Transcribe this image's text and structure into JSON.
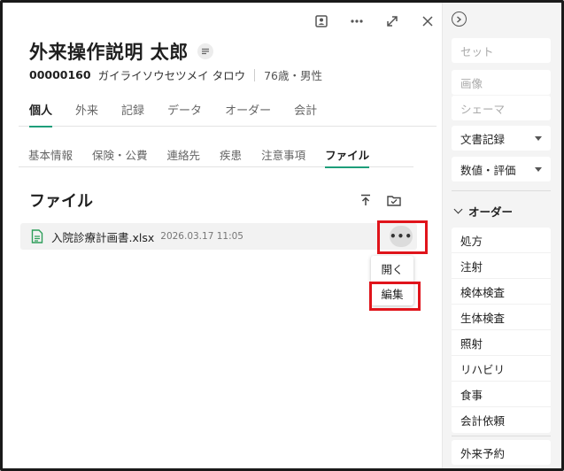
{
  "window_controls": [
    "profile-card-icon",
    "more-horizontal-icon",
    "expand-icon",
    "close-icon"
  ],
  "patient": {
    "name": "外来操作説明 太郎",
    "id": "00000160",
    "kana": "ガイライソウセツメイ タロウ",
    "age_sex": "76歳・男性"
  },
  "main_tabs": [
    "個人",
    "外来",
    "記録",
    "データ",
    "オーダー",
    "会計"
  ],
  "main_tab_active": "個人",
  "sub_tabs": [
    "基本情報",
    "保険・公費",
    "連絡先",
    "疾患",
    "注意事項",
    "ファイル"
  ],
  "sub_tab_active": "ファイル",
  "section": {
    "title": "ファイル",
    "tools": [
      "upload-icon",
      "folder-icon"
    ]
  },
  "file": {
    "name": "入院診療計画書.xlsx",
    "date": "2026.03.17 11:05",
    "more_label": "•••"
  },
  "context_menu": {
    "items": [
      "開く",
      "編集"
    ]
  },
  "sidebar": {
    "set": "セット",
    "image": "画像",
    "schema": "シェーマ",
    "document": "文書記録",
    "numeric": "数値・評価",
    "order_header": "オーダー",
    "orders": [
      "処方",
      "注射",
      "検体検査",
      "生体検査",
      "照射",
      "リハビリ",
      "食事",
      "会計依頼"
    ],
    "appointment": "外来予約"
  },
  "colors": {
    "accent": "#1e9e7a",
    "highlight": "#e0141b",
    "file_icon": "#2e9e5a"
  }
}
